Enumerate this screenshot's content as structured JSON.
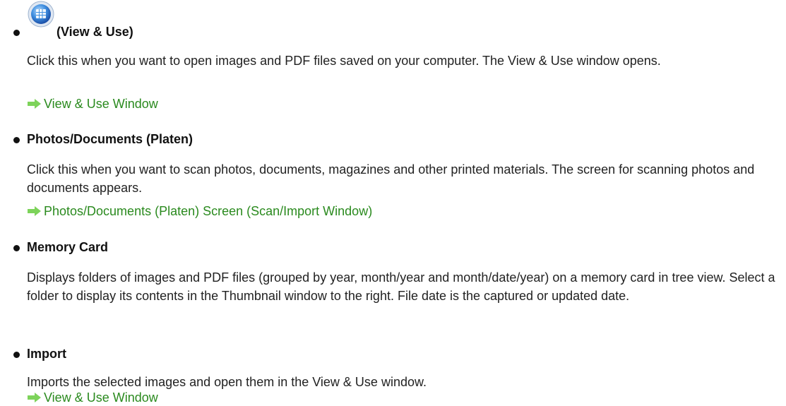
{
  "items": [
    {
      "title": "(View & Use)",
      "icon": "view-and-use-icon",
      "description": "Click this when you want to open images and PDF files saved on your computer. The View & Use window opens.",
      "link": "View & Use Window"
    },
    {
      "title": "Photos/Documents (Platen)",
      "description": "Click this when you want to scan photos, documents, magazines and other printed materials. The screen for scanning photos and documents appears.",
      "link": "Photos/Documents (Platen) Screen (Scan/Import Window)"
    },
    {
      "title": "Memory Card",
      "description": "Displays folders of images and PDF files (grouped by year, month/year and month/date/year) on a memory card in tree view. Select a folder to display its contents in the Thumbnail window to the right. File date is the captured or updated date."
    },
    {
      "title": "Import",
      "description": "Imports the selected images and open them in the View & Use window.",
      "link": "View & Use Window"
    }
  ],
  "colors": {
    "link": "#2a8a1e",
    "arrow": "#7dd35a",
    "text": "#222222"
  }
}
